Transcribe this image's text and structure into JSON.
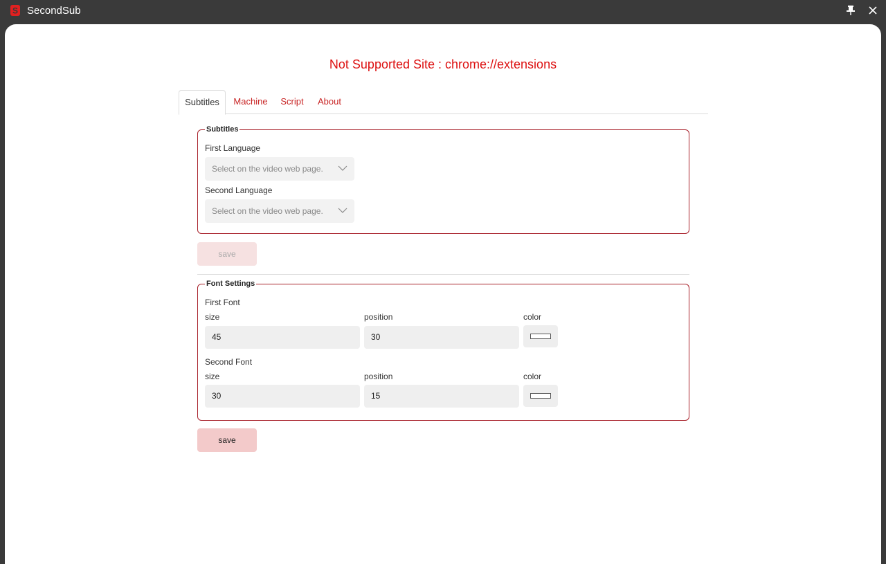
{
  "app": {
    "title": "SecondSub",
    "logo_icon": "secondsub-logo-icon",
    "pin_icon": "pin-icon",
    "close_icon": "close-icon"
  },
  "page": {
    "title": "Not Supported Site : chrome://extensions"
  },
  "tabs": [
    {
      "label": "Subtitles",
      "active": true
    },
    {
      "label": "Machine",
      "active": false
    },
    {
      "label": "Script",
      "active": false
    },
    {
      "label": "About",
      "active": false
    }
  ],
  "subtitles_group": {
    "legend": "Subtitles",
    "first_language_label": "First Language",
    "first_language_value": "Select on the video web page.",
    "second_language_label": "Second Language",
    "second_language_value": "Select on the video web page.",
    "save_label": "save"
  },
  "font_group": {
    "legend": "Font Settings",
    "first_font": {
      "title": "First Font",
      "size_label": "size",
      "size_value": "45",
      "position_label": "position",
      "position_value": "30",
      "color_label": "color",
      "color_value": "#ffffff"
    },
    "second_font": {
      "title": "Second Font",
      "size_label": "size",
      "size_value": "30",
      "position_label": "position",
      "position_value": "15",
      "color_label": "color",
      "color_value": "#ffffff"
    },
    "save_label": "save"
  },
  "colors": {
    "accent": "#dd1111",
    "border": "#a8202a",
    "titlebar": "#3a3a3a"
  }
}
